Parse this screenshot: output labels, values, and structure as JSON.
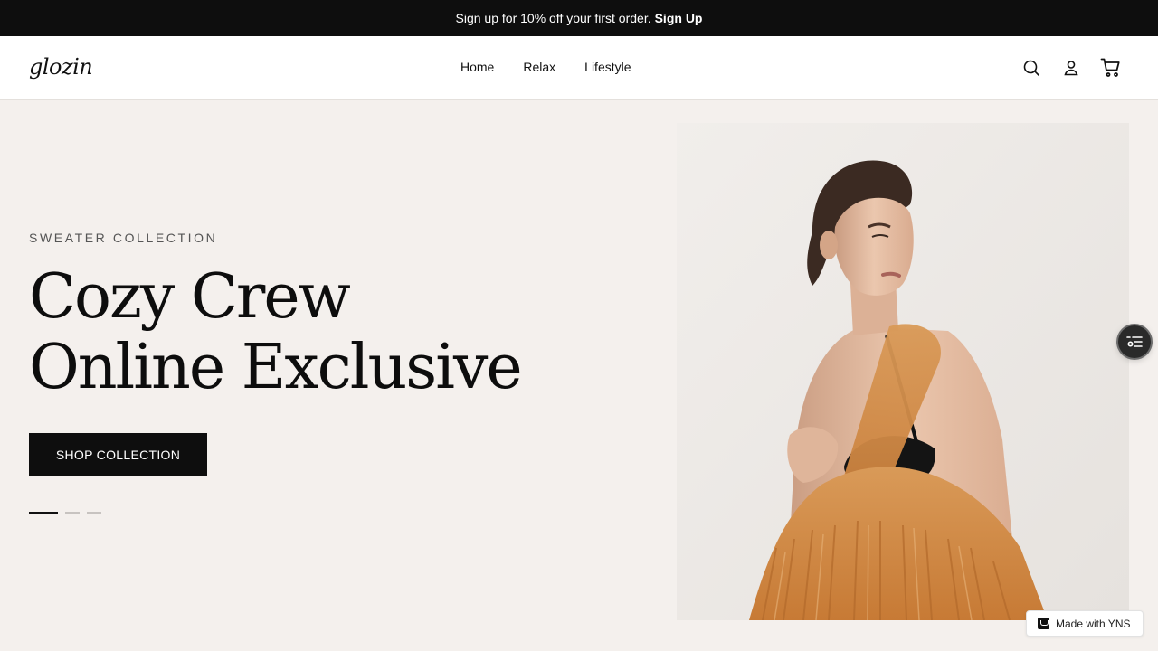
{
  "announcement": {
    "text": "Sign up for 10% off your first order.",
    "link_label": "Sign Up"
  },
  "header": {
    "logo": "glozin",
    "nav": [
      "Home",
      "Relax",
      "Lifestyle"
    ],
    "icons": [
      "search-icon",
      "user-icon",
      "cart-icon"
    ]
  },
  "hero": {
    "eyebrow": "SWEATER COLLECTION",
    "headline_line1": "Cozy Crew",
    "headline_line2": "Online Exclusive",
    "cta_label": "SHOP COLLECTION",
    "slides_total": 3,
    "active_slide": 1
  },
  "widgets": {
    "made_with": "Made with YNS",
    "fab_icon": "filter-list-icon"
  },
  "colors": {
    "background": "#f4f0ed",
    "announcement_bg": "#0e0e0e",
    "text": "#111111",
    "bag": "#d38a45"
  }
}
